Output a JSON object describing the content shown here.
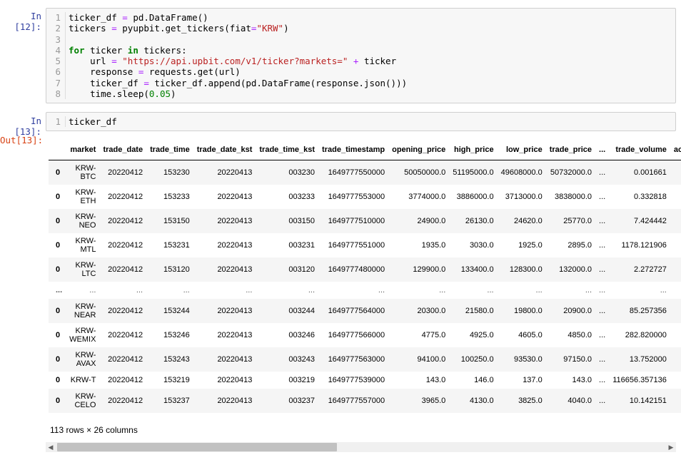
{
  "cells": [
    {
      "prompt": "In [12]:",
      "lines": [
        {
          "n": "1",
          "t": [
            [
              "src",
              "ticker_df "
            ],
            [
              "op",
              "="
            ],
            [
              "src",
              " pd.DataFrame()"
            ]
          ]
        },
        {
          "n": "2",
          "t": [
            [
              "src",
              "tickers "
            ],
            [
              "op",
              "="
            ],
            [
              "src",
              " pyupbit.get_tickers(fiat"
            ],
            [
              "op",
              "="
            ],
            [
              "str",
              "\"KRW\""
            ],
            [
              "src",
              ")"
            ]
          ]
        },
        {
          "n": "3",
          "t": []
        },
        {
          "n": "4",
          "t": [
            [
              "kw",
              "for"
            ],
            [
              "src",
              " ticker "
            ],
            [
              "kw",
              "in"
            ],
            [
              "src",
              " tickers:"
            ]
          ]
        },
        {
          "n": "5",
          "t": [
            [
              "src",
              "    url "
            ],
            [
              "op",
              "="
            ],
            [
              "src",
              " "
            ],
            [
              "str",
              "\"https://api.upbit.com/v1/ticker?markets=\""
            ],
            [
              "src",
              " "
            ],
            [
              "op",
              "+"
            ],
            [
              "src",
              " ticker"
            ]
          ]
        },
        {
          "n": "6",
          "t": [
            [
              "src",
              "    response "
            ],
            [
              "op",
              "="
            ],
            [
              "src",
              " requests.get(url)"
            ]
          ]
        },
        {
          "n": "7",
          "t": [
            [
              "src",
              "    ticker_df "
            ],
            [
              "op",
              "="
            ],
            [
              "src",
              " ticker_df.append(pd.DataFrame(response.json()))"
            ]
          ]
        },
        {
          "n": "8",
          "t": [
            [
              "src",
              "    time.sleep("
            ],
            [
              "num",
              "0.05"
            ],
            [
              "src",
              ")"
            ]
          ]
        }
      ]
    },
    {
      "prompt": "In [13]:",
      "lines": [
        {
          "n": "1",
          "t": [
            [
              "src",
              "ticker_df"
            ]
          ]
        }
      ]
    }
  ],
  "output_prompt": "Out[13]:",
  "table": {
    "columns": [
      "",
      "market",
      "trade_date",
      "trade_time",
      "trade_date_kst",
      "trade_time_kst",
      "trade_timestamp",
      "opening_price",
      "high_price",
      "low_price",
      "trade_price",
      "...",
      "trade_volume",
      "ac"
    ],
    "rows": [
      [
        "0",
        "KRW-\nBTC",
        "20220412",
        "153230",
        "20220413",
        "003230",
        "1649777550000",
        "50050000.0",
        "51195000.0",
        "49608000.0",
        "50732000.0",
        "...",
        "0.001661",
        ""
      ],
      [
        "0",
        "KRW-\nETH",
        "20220412",
        "153233",
        "20220413",
        "003233",
        "1649777553000",
        "3774000.0",
        "3886000.0",
        "3713000.0",
        "3838000.0",
        "...",
        "0.332818",
        ""
      ],
      [
        "0",
        "KRW-\nNEO",
        "20220412",
        "153150",
        "20220413",
        "003150",
        "1649777510000",
        "24900.0",
        "26130.0",
        "24620.0",
        "25770.0",
        "...",
        "7.424442",
        ""
      ],
      [
        "0",
        "KRW-\nMTL",
        "20220412",
        "153231",
        "20220413",
        "003231",
        "1649777551000",
        "1935.0",
        "3030.0",
        "1925.0",
        "2895.0",
        "...",
        "1178.121906",
        ""
      ],
      [
        "0",
        "KRW-\nLTC",
        "20220412",
        "153120",
        "20220413",
        "003120",
        "1649777480000",
        "129900.0",
        "133400.0",
        "128300.0",
        "132000.0",
        "...",
        "2.272727",
        ""
      ],
      [
        "...",
        "...",
        "...",
        "...",
        "...",
        "...",
        "...",
        "...",
        "...",
        "...",
        "...",
        "...",
        "...",
        ""
      ],
      [
        "0",
        "KRW-\nNEAR",
        "20220412",
        "153244",
        "20220413",
        "003244",
        "1649777564000",
        "20300.0",
        "21580.0",
        "19800.0",
        "20900.0",
        "...",
        "85.257356",
        ""
      ],
      [
        "0",
        "KRW-\nWEMIX",
        "20220412",
        "153246",
        "20220413",
        "003246",
        "1649777566000",
        "4775.0",
        "4925.0",
        "4605.0",
        "4850.0",
        "...",
        "282.820000",
        ""
      ],
      [
        "0",
        "KRW-\nAVAX",
        "20220412",
        "153243",
        "20220413",
        "003243",
        "1649777563000",
        "94100.0",
        "100250.0",
        "93530.0",
        "97150.0",
        "...",
        "13.752000",
        ""
      ],
      [
        "0",
        "KRW-T",
        "20220412",
        "153219",
        "20220413",
        "003219",
        "1649777539000",
        "143.0",
        "146.0",
        "137.0",
        "143.0",
        "...",
        "116656.357136",
        ""
      ],
      [
        "0",
        "KRW-\nCELO",
        "20220412",
        "153237",
        "20220413",
        "003237",
        "1649777557000",
        "3965.0",
        "4130.0",
        "3825.0",
        "4040.0",
        "...",
        "10.142151",
        ""
      ]
    ]
  },
  "shape_text": "113 rows × 26 columns",
  "scroll": {
    "left_arrow": "◀",
    "right_arrow": "▶"
  }
}
